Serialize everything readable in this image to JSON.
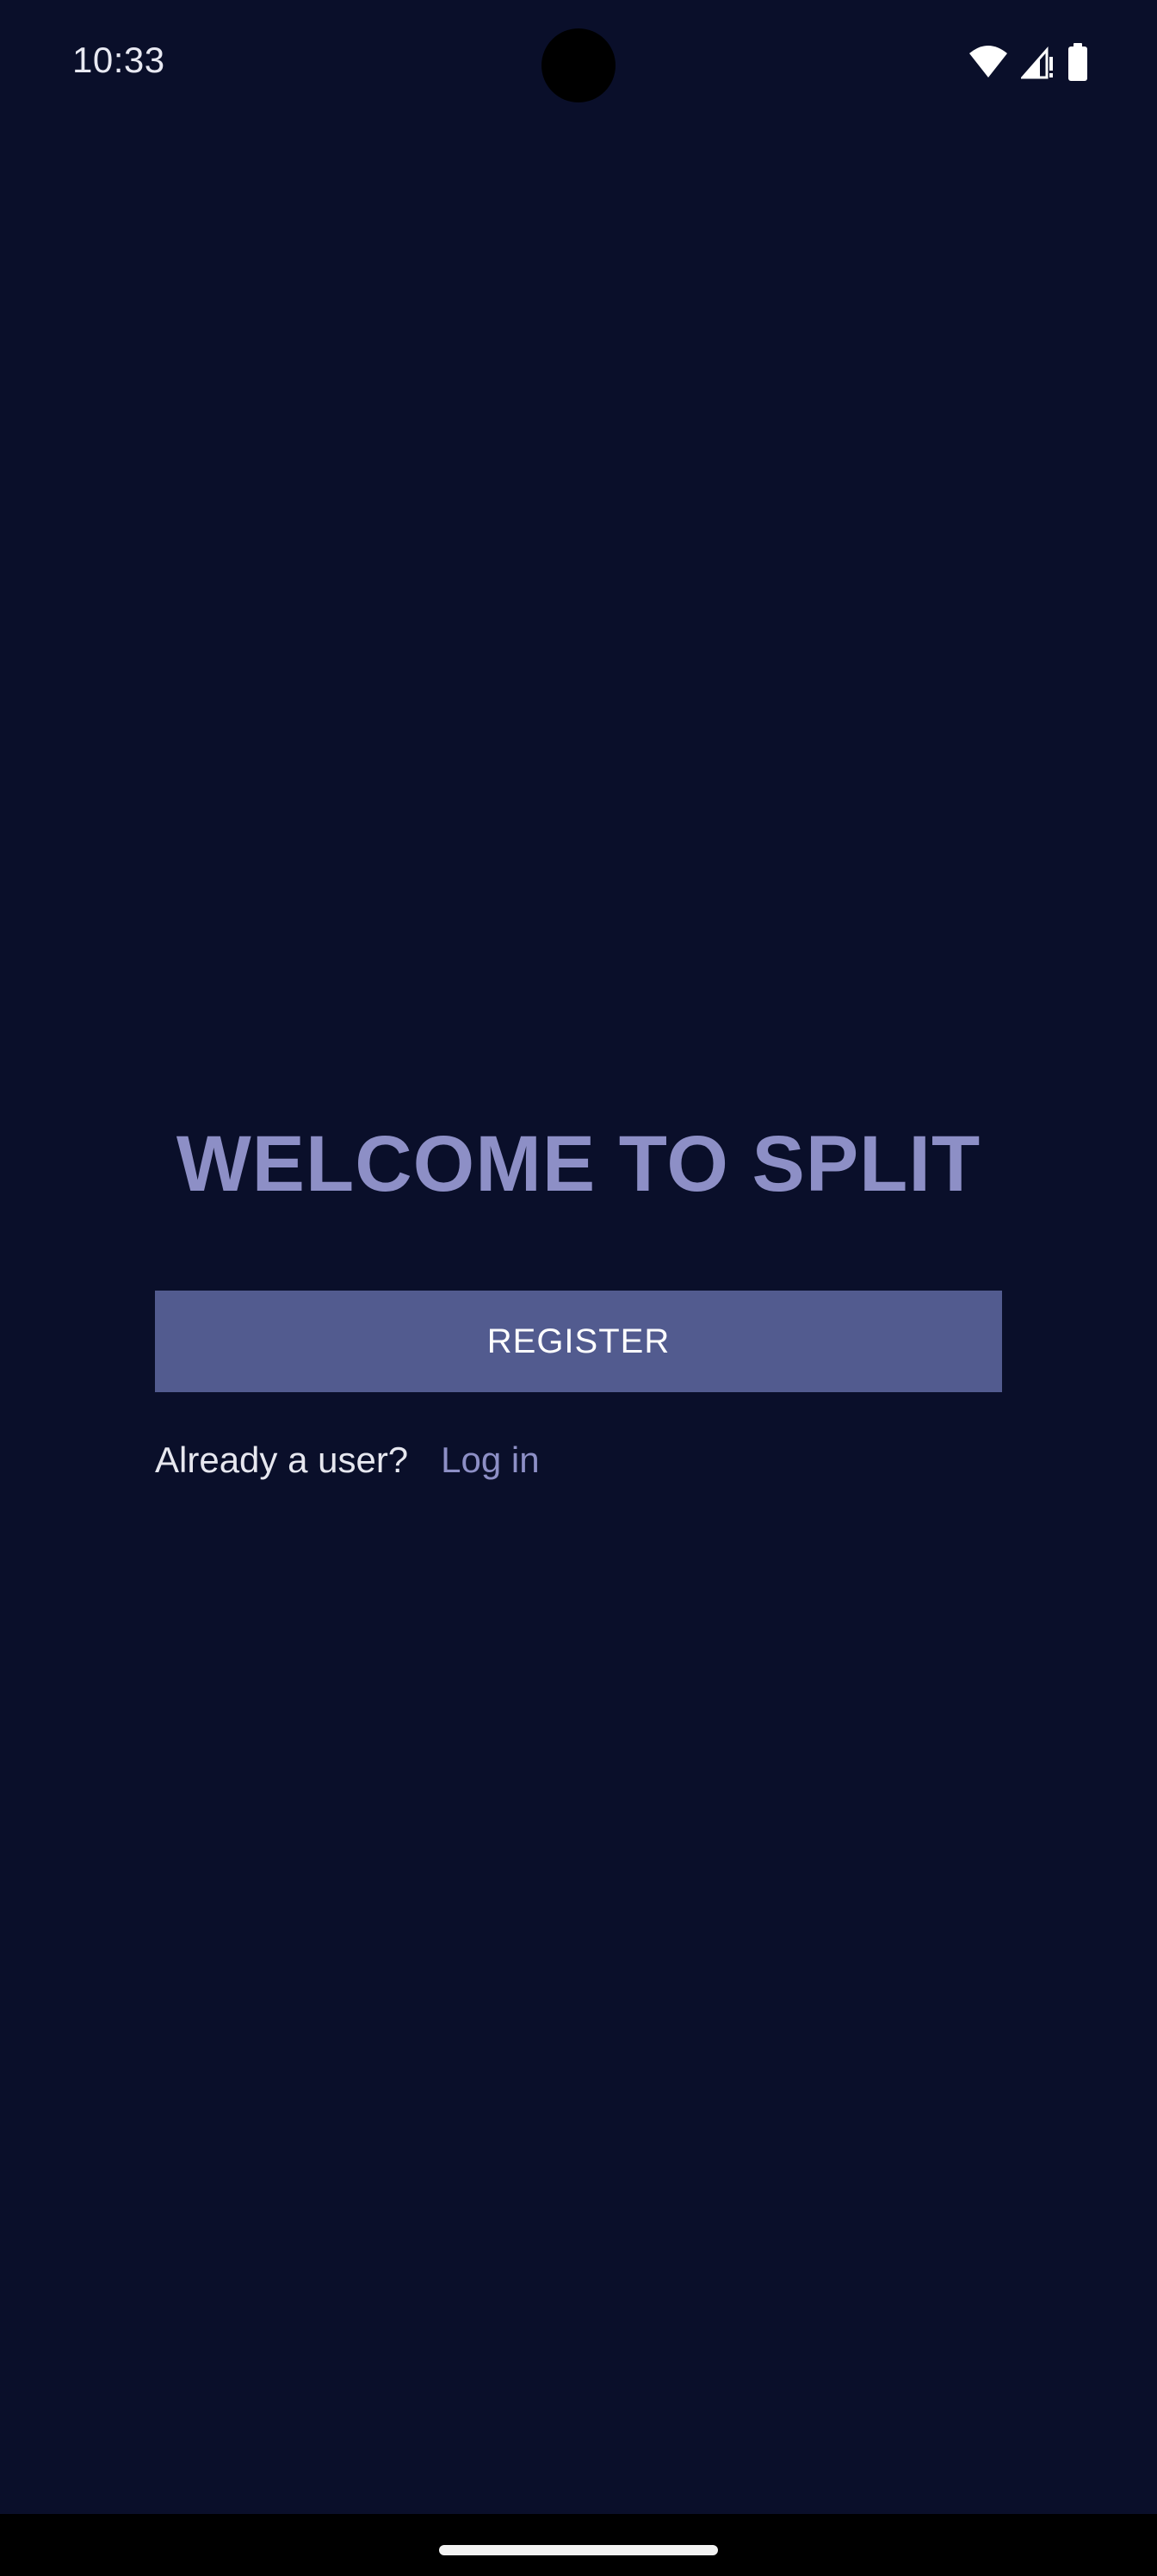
{
  "status_bar": {
    "time": "10:33",
    "icons": [
      "wifi-icon",
      "signal-icon",
      "battery-icon"
    ]
  },
  "main": {
    "title": "WELCOME TO SPLIT",
    "register_label": "REGISTER",
    "already_user_text": "Already a user?",
    "login_label": "Log in"
  },
  "colors": {
    "background": "#0a0f2a",
    "accent": "#8d8fc6",
    "button": "#525b8f"
  }
}
